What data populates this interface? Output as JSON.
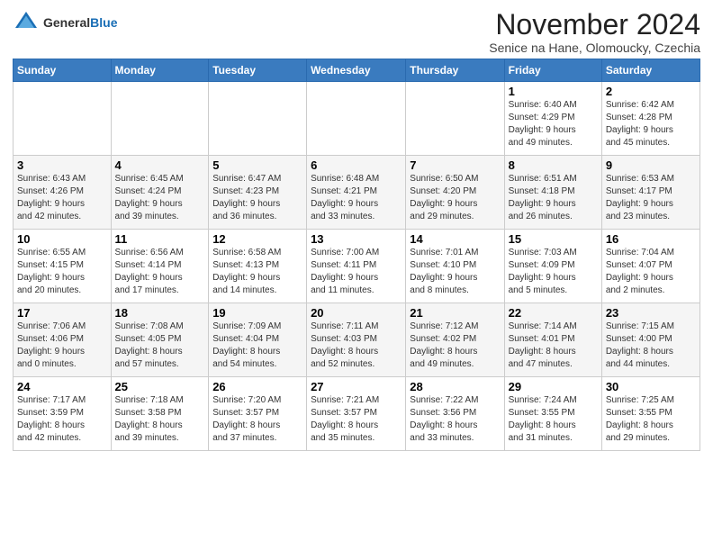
{
  "header": {
    "logo_general": "General",
    "logo_blue": "Blue",
    "title": "November 2024",
    "location": "Senice na Hane, Olomoucky, Czechia"
  },
  "columns": [
    "Sunday",
    "Monday",
    "Tuesday",
    "Wednesday",
    "Thursday",
    "Friday",
    "Saturday"
  ],
  "weeks": [
    [
      {
        "day": "",
        "info": ""
      },
      {
        "day": "",
        "info": ""
      },
      {
        "day": "",
        "info": ""
      },
      {
        "day": "",
        "info": ""
      },
      {
        "day": "",
        "info": ""
      },
      {
        "day": "1",
        "info": "Sunrise: 6:40 AM\nSunset: 4:29 PM\nDaylight: 9 hours\nand 49 minutes."
      },
      {
        "day": "2",
        "info": "Sunrise: 6:42 AM\nSunset: 4:28 PM\nDaylight: 9 hours\nand 45 minutes."
      }
    ],
    [
      {
        "day": "3",
        "info": "Sunrise: 6:43 AM\nSunset: 4:26 PM\nDaylight: 9 hours\nand 42 minutes."
      },
      {
        "day": "4",
        "info": "Sunrise: 6:45 AM\nSunset: 4:24 PM\nDaylight: 9 hours\nand 39 minutes."
      },
      {
        "day": "5",
        "info": "Sunrise: 6:47 AM\nSunset: 4:23 PM\nDaylight: 9 hours\nand 36 minutes."
      },
      {
        "day": "6",
        "info": "Sunrise: 6:48 AM\nSunset: 4:21 PM\nDaylight: 9 hours\nand 33 minutes."
      },
      {
        "day": "7",
        "info": "Sunrise: 6:50 AM\nSunset: 4:20 PM\nDaylight: 9 hours\nand 29 minutes."
      },
      {
        "day": "8",
        "info": "Sunrise: 6:51 AM\nSunset: 4:18 PM\nDaylight: 9 hours\nand 26 minutes."
      },
      {
        "day": "9",
        "info": "Sunrise: 6:53 AM\nSunset: 4:17 PM\nDaylight: 9 hours\nand 23 minutes."
      }
    ],
    [
      {
        "day": "10",
        "info": "Sunrise: 6:55 AM\nSunset: 4:15 PM\nDaylight: 9 hours\nand 20 minutes."
      },
      {
        "day": "11",
        "info": "Sunrise: 6:56 AM\nSunset: 4:14 PM\nDaylight: 9 hours\nand 17 minutes."
      },
      {
        "day": "12",
        "info": "Sunrise: 6:58 AM\nSunset: 4:13 PM\nDaylight: 9 hours\nand 14 minutes."
      },
      {
        "day": "13",
        "info": "Sunrise: 7:00 AM\nSunset: 4:11 PM\nDaylight: 9 hours\nand 11 minutes."
      },
      {
        "day": "14",
        "info": "Sunrise: 7:01 AM\nSunset: 4:10 PM\nDaylight: 9 hours\nand 8 minutes."
      },
      {
        "day": "15",
        "info": "Sunrise: 7:03 AM\nSunset: 4:09 PM\nDaylight: 9 hours\nand 5 minutes."
      },
      {
        "day": "16",
        "info": "Sunrise: 7:04 AM\nSunset: 4:07 PM\nDaylight: 9 hours\nand 2 minutes."
      }
    ],
    [
      {
        "day": "17",
        "info": "Sunrise: 7:06 AM\nSunset: 4:06 PM\nDaylight: 9 hours\nand 0 minutes."
      },
      {
        "day": "18",
        "info": "Sunrise: 7:08 AM\nSunset: 4:05 PM\nDaylight: 8 hours\nand 57 minutes."
      },
      {
        "day": "19",
        "info": "Sunrise: 7:09 AM\nSunset: 4:04 PM\nDaylight: 8 hours\nand 54 minutes."
      },
      {
        "day": "20",
        "info": "Sunrise: 7:11 AM\nSunset: 4:03 PM\nDaylight: 8 hours\nand 52 minutes."
      },
      {
        "day": "21",
        "info": "Sunrise: 7:12 AM\nSunset: 4:02 PM\nDaylight: 8 hours\nand 49 minutes."
      },
      {
        "day": "22",
        "info": "Sunrise: 7:14 AM\nSunset: 4:01 PM\nDaylight: 8 hours\nand 47 minutes."
      },
      {
        "day": "23",
        "info": "Sunrise: 7:15 AM\nSunset: 4:00 PM\nDaylight: 8 hours\nand 44 minutes."
      }
    ],
    [
      {
        "day": "24",
        "info": "Sunrise: 7:17 AM\nSunset: 3:59 PM\nDaylight: 8 hours\nand 42 minutes."
      },
      {
        "day": "25",
        "info": "Sunrise: 7:18 AM\nSunset: 3:58 PM\nDaylight: 8 hours\nand 39 minutes."
      },
      {
        "day": "26",
        "info": "Sunrise: 7:20 AM\nSunset: 3:57 PM\nDaylight: 8 hours\nand 37 minutes."
      },
      {
        "day": "27",
        "info": "Sunrise: 7:21 AM\nSunset: 3:57 PM\nDaylight: 8 hours\nand 35 minutes."
      },
      {
        "day": "28",
        "info": "Sunrise: 7:22 AM\nSunset: 3:56 PM\nDaylight: 8 hours\nand 33 minutes."
      },
      {
        "day": "29",
        "info": "Sunrise: 7:24 AM\nSunset: 3:55 PM\nDaylight: 8 hours\nand 31 minutes."
      },
      {
        "day": "30",
        "info": "Sunrise: 7:25 AM\nSunset: 3:55 PM\nDaylight: 8 hours\nand 29 minutes."
      }
    ]
  ]
}
